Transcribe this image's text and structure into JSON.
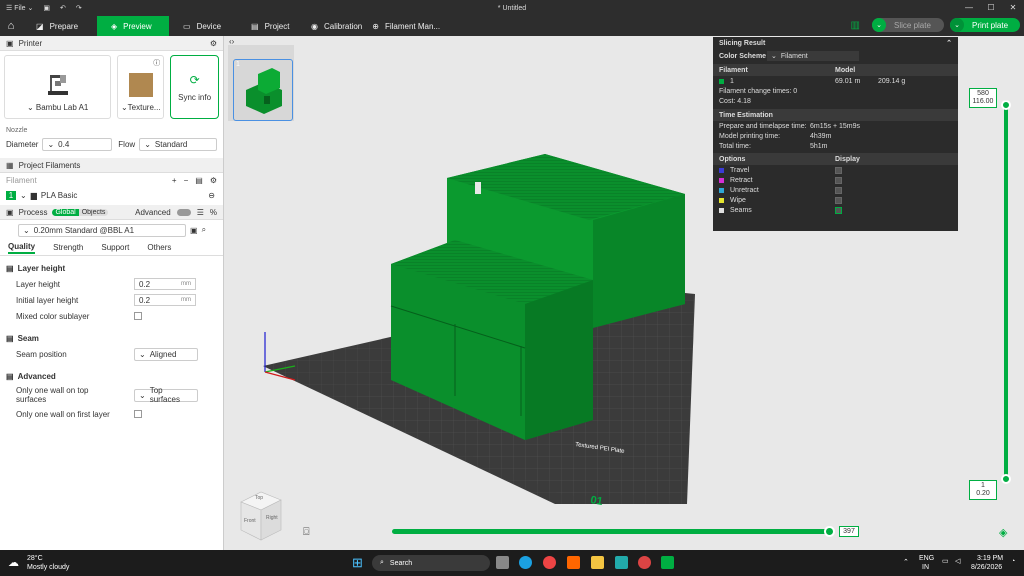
{
  "titlebar": {
    "file": "File",
    "title": "* Untitled"
  },
  "nav": {
    "tabs": [
      {
        "label": "Prepare"
      },
      {
        "label": "Preview"
      },
      {
        "label": "Device"
      },
      {
        "label": "Project"
      },
      {
        "label": "Calibration"
      },
      {
        "label": "Filament Man..."
      }
    ],
    "slice_label": "Slice plate",
    "print_label": "Print plate"
  },
  "printer": {
    "section": "Printer",
    "name": "Bambu Lab A1",
    "plate": "Texture...",
    "sync": "Sync info",
    "nozzle_label": "Nozzle",
    "diameter_label": "Diameter",
    "diameter": "0.4",
    "flow_label": "Flow",
    "flow": "Standard"
  },
  "filaments": {
    "section": "Project Filaments",
    "label": "Filament",
    "items": [
      {
        "index": "1",
        "name": "PLA Basic",
        "color": "#00ae42"
      }
    ]
  },
  "process": {
    "section": "Process",
    "global": "Global",
    "objects": "Objects",
    "advanced": "Advanced",
    "preset": "0.20mm Standard @BBL A1",
    "tabs": [
      "Quality",
      "Strength",
      "Support",
      "Others"
    ],
    "groups": {
      "layer": "Layer height",
      "seam": "Seam",
      "advanced": "Advanced"
    },
    "options": {
      "layer_height": {
        "label": "Layer height",
        "value": "0.2",
        "unit": "mm"
      },
      "initial_layer": {
        "label": "Initial layer height",
        "value": "0.2",
        "unit": "mm"
      },
      "mixed": {
        "label": "Mixed color sublayer"
      },
      "seam_pos": {
        "label": "Seam position",
        "value": "Aligned"
      },
      "one_wall_top": {
        "label": "Only one wall on top surfaces",
        "value": "Top surfaces"
      },
      "one_wall_first": {
        "label": "Only one wall on first layer"
      }
    }
  },
  "slicing": {
    "title": "Slicing Result",
    "color_scheme_label": "Color Scheme",
    "color_scheme": "Filament",
    "col_filament": "Filament",
    "col_model": "Model",
    "fil_index": "1",
    "fil_length": "69.01 m",
    "fil_weight": "209.14 g",
    "change_times": "Filament change times:  0",
    "cost": "Cost:  4.18",
    "time_head": "Time Estimation",
    "prepare_label": "Prepare and timelapse time:",
    "prepare_value": "6m15s + 15m9s",
    "model_time_label": "Model printing time:",
    "model_time_value": "4h39m",
    "total_label": "Total time:",
    "total_value": "5h1m",
    "options_head": "Options",
    "display_head": "Display",
    "options": [
      {
        "label": "Travel",
        "color": "#3b3bd6"
      },
      {
        "label": "Retract",
        "color": "#d62fd6"
      },
      {
        "label": "Unretract",
        "color": "#2fa8d6"
      },
      {
        "label": "Wipe",
        "color": "#e6e62f"
      },
      {
        "label": "Seams",
        "color": "#e0e0e0"
      }
    ]
  },
  "layers": {
    "top_a": "580",
    "top_b": "116.00",
    "bottom_a": "1",
    "bottom_b": "0.20",
    "moves": "397"
  },
  "plate": {
    "number": "01",
    "label": "Textured PEI Plate"
  },
  "cube": {
    "top": "Top",
    "front": "Front",
    "right": "Right"
  },
  "taskbar": {
    "weather_temp": "28°C",
    "weather_desc": "Mostly cloudy",
    "search": "Search",
    "lang": "ENG",
    "region": "IN",
    "time": "3:19 PM",
    "date": "8/26/2026"
  },
  "colors": {
    "accent": "#00ae42",
    "model": "#0a8f2c"
  }
}
